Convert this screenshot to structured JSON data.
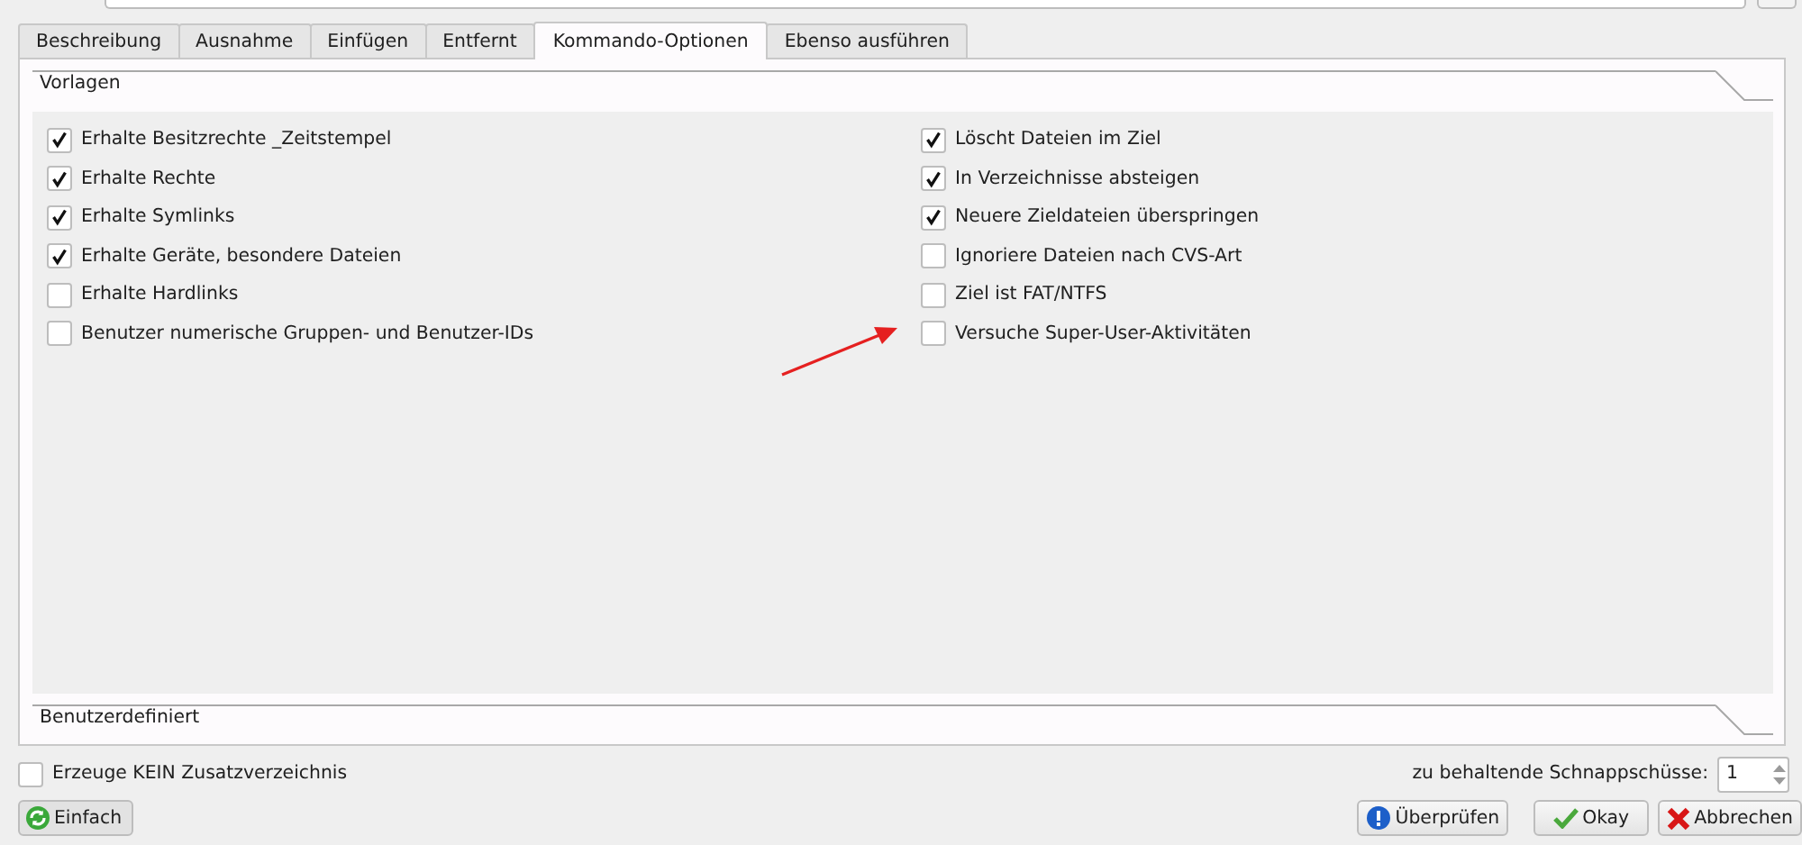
{
  "tabs": [
    {
      "label": "Beschreibung",
      "selected": false
    },
    {
      "label": "Ausnahme",
      "selected": false
    },
    {
      "label": "Einfügen",
      "selected": false
    },
    {
      "label": "Entfernt",
      "selected": false
    },
    {
      "label": "Kommando-Optionen",
      "selected": true
    },
    {
      "label": "Ebenso ausführen",
      "selected": false
    }
  ],
  "sections": [
    {
      "title": "Vorlagen",
      "expanded": true,
      "columns": [
        [
          {
            "label": "Erhalte Besitzrechte _Zeitstempel",
            "checked": true
          },
          {
            "label": "Erhalte Rechte",
            "checked": true
          },
          {
            "label": "Erhalte Symlinks",
            "checked": true
          },
          {
            "label": "Erhalte Geräte, besondere Dateien",
            "checked": true
          },
          {
            "label": "Erhalte Hardlinks",
            "checked": false
          },
          {
            "label": "Benutzer numerische Gruppen- und Benutzer-IDs",
            "checked": false
          }
        ],
        [
          {
            "label": "Löscht Dateien im Ziel",
            "checked": true
          },
          {
            "label": "In Verzeichnisse absteigen",
            "checked": true
          },
          {
            "label": "Neuere Zieldateien überspringen",
            "checked": true
          },
          {
            "label": "Ignoriere Dateien nach CVS-Art",
            "checked": false
          },
          {
            "label": "Ziel ist FAT/NTFS",
            "checked": false
          },
          {
            "label": "Versuche Super-User-Aktivitäten",
            "checked": false
          }
        ]
      ]
    },
    {
      "title": "Benutzerdefiniert",
      "expanded": false
    }
  ],
  "no_extra_dir": {
    "label": "Erzeuge KEIN Zusatzverzeichnis",
    "checked": false
  },
  "snapshots": {
    "label": "zu behaltende Schnappschüsse:",
    "value": "1"
  },
  "buttons": [
    {
      "label": "Einfach",
      "kind": "simple"
    },
    {
      "label": "Überprüfen",
      "kind": "check"
    },
    {
      "label": "Okay",
      "kind": "ok"
    },
    {
      "label": "Abbrechen",
      "kind": "cancel"
    }
  ]
}
